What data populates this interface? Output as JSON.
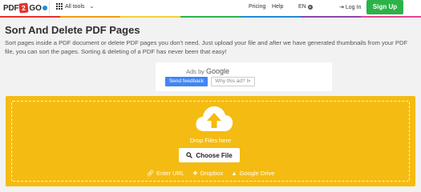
{
  "header": {
    "logo": {
      "left": "PDF",
      "middle": "2",
      "right": "GO"
    },
    "all_tools_label": "All tools",
    "nav": {
      "pricing": "Pricing",
      "help": "Help"
    },
    "language": "EN",
    "login": "Log In",
    "signup": "Sign Up"
  },
  "rainbow_colors": [
    "#e3312d",
    "#f39c12",
    "#f4d03f",
    "#2bb34a",
    "#1f8bd6",
    "#8e44ad",
    "#e84393"
  ],
  "page": {
    "title": "Sort And Delete PDF Pages",
    "description": "Sort pages inside a PDF document or delete PDF pages you don't need. Just upload your file and after we have generated thumbnails from your PDF file, you can sort the pages. Sorting & deleting of a PDF has never been that easy!"
  },
  "ad": {
    "ads_by": "Ads by",
    "brand": "Google",
    "send_feedback": "Send feedback",
    "why_this_ad": "Why this ad? ⊳"
  },
  "upload": {
    "drop_text": "Drop Files here",
    "choose_file": "Choose File",
    "sources": {
      "enter_url": "Enter URL",
      "dropbox": "Dropbox",
      "google_drive": "Google Drive"
    },
    "accent_color": "#f4bb12"
  }
}
